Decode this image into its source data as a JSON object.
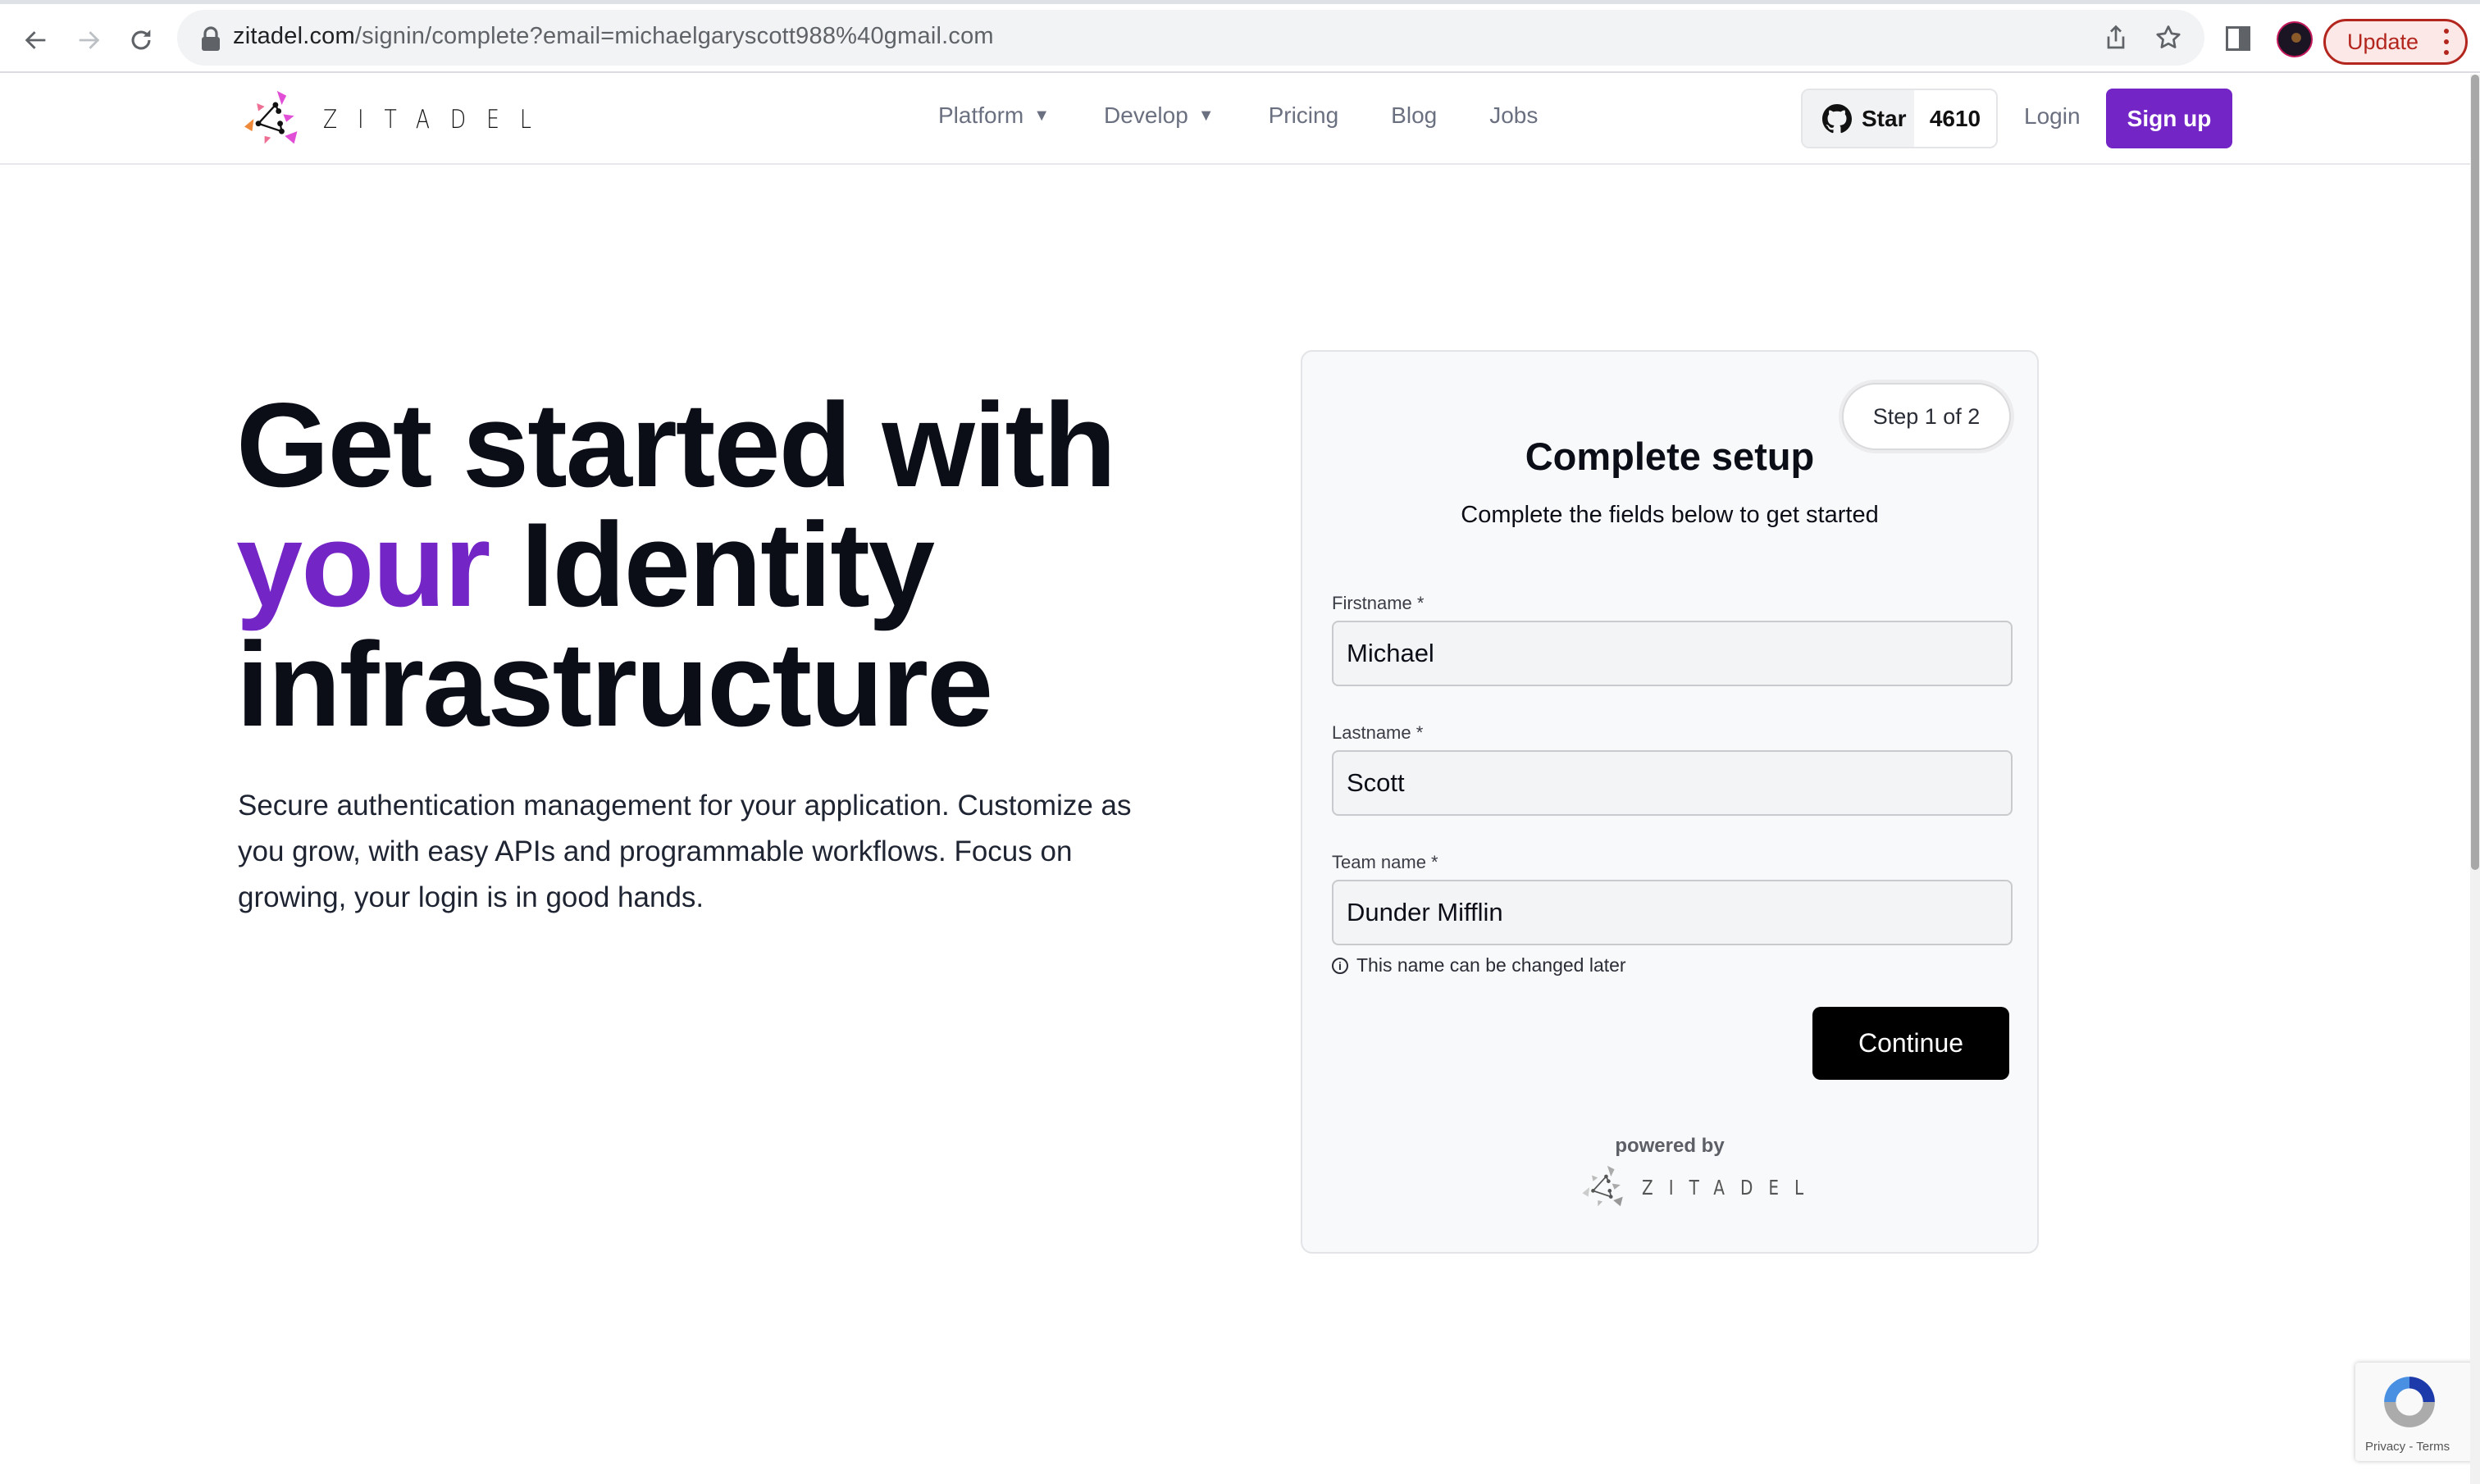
{
  "browser": {
    "url_host": "zitadel.com",
    "url_path": "/signin/complete?email=michaelgaryscott988%40gmail.com",
    "update_label": "Update"
  },
  "site": {
    "logo_text": "ZITADEL",
    "nav": [
      {
        "label": "Platform",
        "has_dropdown": true
      },
      {
        "label": "Develop",
        "has_dropdown": true
      },
      {
        "label": "Pricing",
        "has_dropdown": false
      },
      {
        "label": "Blog",
        "has_dropdown": false
      },
      {
        "label": "Jobs",
        "has_dropdown": false
      }
    ],
    "dropdown_caret": "▼",
    "github_star_label": "Star",
    "github_star_count": "4610",
    "login_label": "Login",
    "signup_label": "Sign up",
    "accent_color": "#7425c6"
  },
  "hero": {
    "title_line1": "Get started with",
    "title_accent": "your",
    "title_line2_rest": " Identity",
    "title_line3": "infrastructure",
    "description": "Secure authentication management for your application. Customize as you grow, with easy APIs and programmable workflows. Focus on growing, your login is in good hands."
  },
  "form": {
    "step_label": "Step 1 of 2",
    "title": "Complete setup",
    "subtitle": "Complete the fields below to get started",
    "fields": [
      {
        "label": "Firstname *",
        "value": "Michael"
      },
      {
        "label": "Lastname *",
        "value": "Scott"
      },
      {
        "label": "Team name *",
        "value": "Dunder Mifflin"
      }
    ],
    "hint": "This name can be changed later",
    "hint_icon": "i",
    "continue_label": "Continue",
    "powered_by": "powered by",
    "powered_logo_text": "ZITADEL"
  },
  "recaptcha": {
    "links": "Privacy - Terms"
  }
}
